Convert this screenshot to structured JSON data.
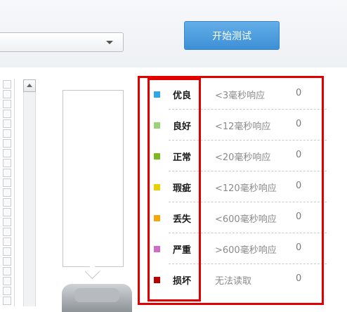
{
  "toolbar": {
    "start_button_label": "开始测试",
    "select_value": ""
  },
  "legend": {
    "items": [
      {
        "label": "优良",
        "desc": "<3毫秒响应",
        "count": "0",
        "color": "#2fa7e6"
      },
      {
        "label": "良好",
        "desc": "<12毫秒响应",
        "count": "0",
        "color": "#9bd27a"
      },
      {
        "label": "正常",
        "desc": "<20毫秒响应",
        "count": "0",
        "color": "#7cba20"
      },
      {
        "label": "瑕疵",
        "desc": "<120毫秒响应",
        "count": "0",
        "color": "#e9d100"
      },
      {
        "label": "丢失",
        "desc": "<600毫秒响应",
        "count": "0",
        "color": "#f4a70c"
      },
      {
        "label": "严重",
        "desc": ">600毫秒响应",
        "count": "0",
        "color": "#d26ac7"
      },
      {
        "label": "损坏",
        "desc": "无法读取",
        "count": "0",
        "color": "#b80000"
      }
    ]
  },
  "annotation": {
    "highlight_color": "#e00000"
  }
}
